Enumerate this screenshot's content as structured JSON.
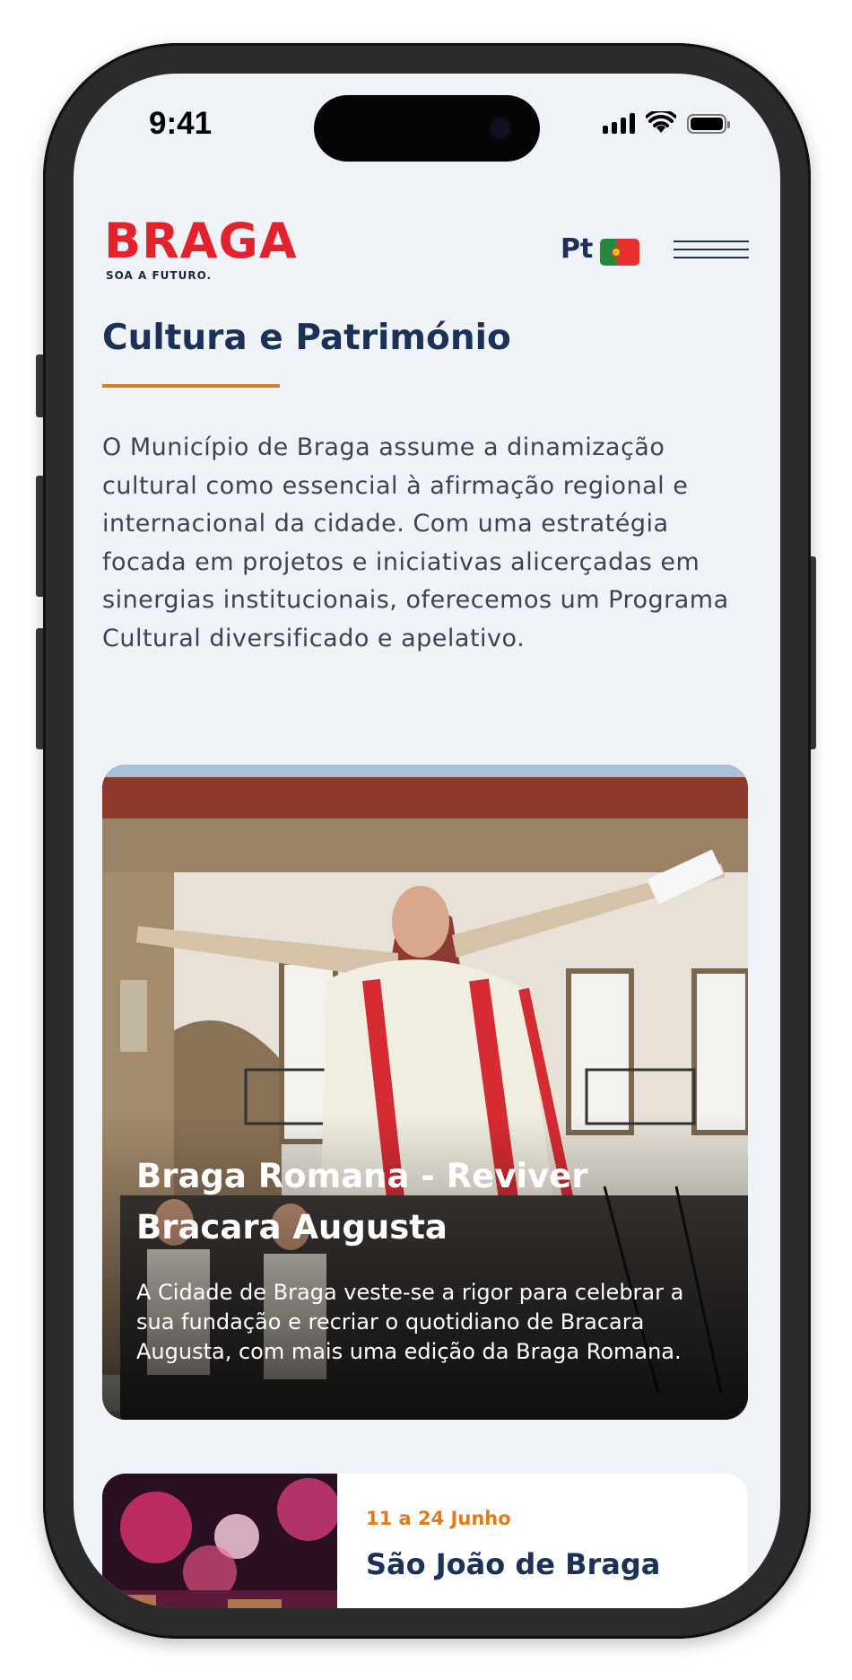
{
  "status_bar": {
    "time": "9:41"
  },
  "header": {
    "logo_text": "BRAGA",
    "logo_tagline": "SOA A FUTURO.",
    "language_label": "Pt"
  },
  "page": {
    "title": "Cultura e Património",
    "intro": "O Município de Braga assume a dinamização cultural como essencial à afirmação regional e internacional da cidade. Com uma estratégia focada em projetos e iniciativas alicerçadas em sinergias institucionais, oferecemos um Programa Cultural diversificado e apelativo."
  },
  "featured": {
    "title": "Braga Romana - Reviver Bracara Augusta",
    "description": "A Cidade de Braga veste-se a rigor para celebrar a sua fundação e recriar o quotidiano de Bracara Augusta, com mais uma edição da Braga Romana."
  },
  "events": [
    {
      "date": "11 a 24 Junho",
      "title": "São João de Braga"
    }
  ],
  "colors": {
    "brand_red": "#e4222b",
    "navy": "#1b3158",
    "accent_orange": "#e07b1b",
    "background": "#eff2f7"
  },
  "icons": [
    "signal-icon",
    "wifi-icon",
    "battery-icon",
    "portugal-flag-icon",
    "hamburger-menu-icon"
  ]
}
